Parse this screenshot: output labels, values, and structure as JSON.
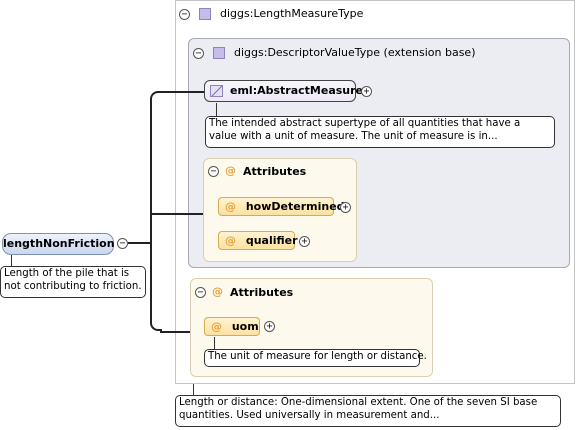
{
  "root": {
    "name": "lengthNonFriction",
    "annotation": "Length of the pile that is not contributing to friction."
  },
  "length_type": {
    "name": "diggs:LengthMeasureType",
    "annotation": "Length or distance: One-dimensional extent. One of the seven SI base quantities. Used universally in measurement and...",
    "extension": {
      "name": "diggs:DescriptorValueType (extension base)",
      "element": {
        "name": "eml:AbstractMeasure",
        "annotation": "The intended abstract supertype of all quantities that have a value with a unit of measure. The unit of measure is in..."
      },
      "attributes": {
        "header": "Attributes",
        "items": [
          "howDetermined",
          "qualifier"
        ]
      }
    },
    "attributes": {
      "header": "Attributes",
      "uom": {
        "name": "uom",
        "annotation": "The unit of measure for length or distance."
      }
    }
  },
  "symbols": {
    "collapse": "−",
    "expand": "+",
    "attribute": "@"
  },
  "colors": {
    "extension_bg": "#ececf3",
    "attribute_bg": "#fdf9ec",
    "attribute_pill": "#fbe1a1",
    "root_pill": "#c9d6ec",
    "type_icon": "#c7bdea"
  }
}
